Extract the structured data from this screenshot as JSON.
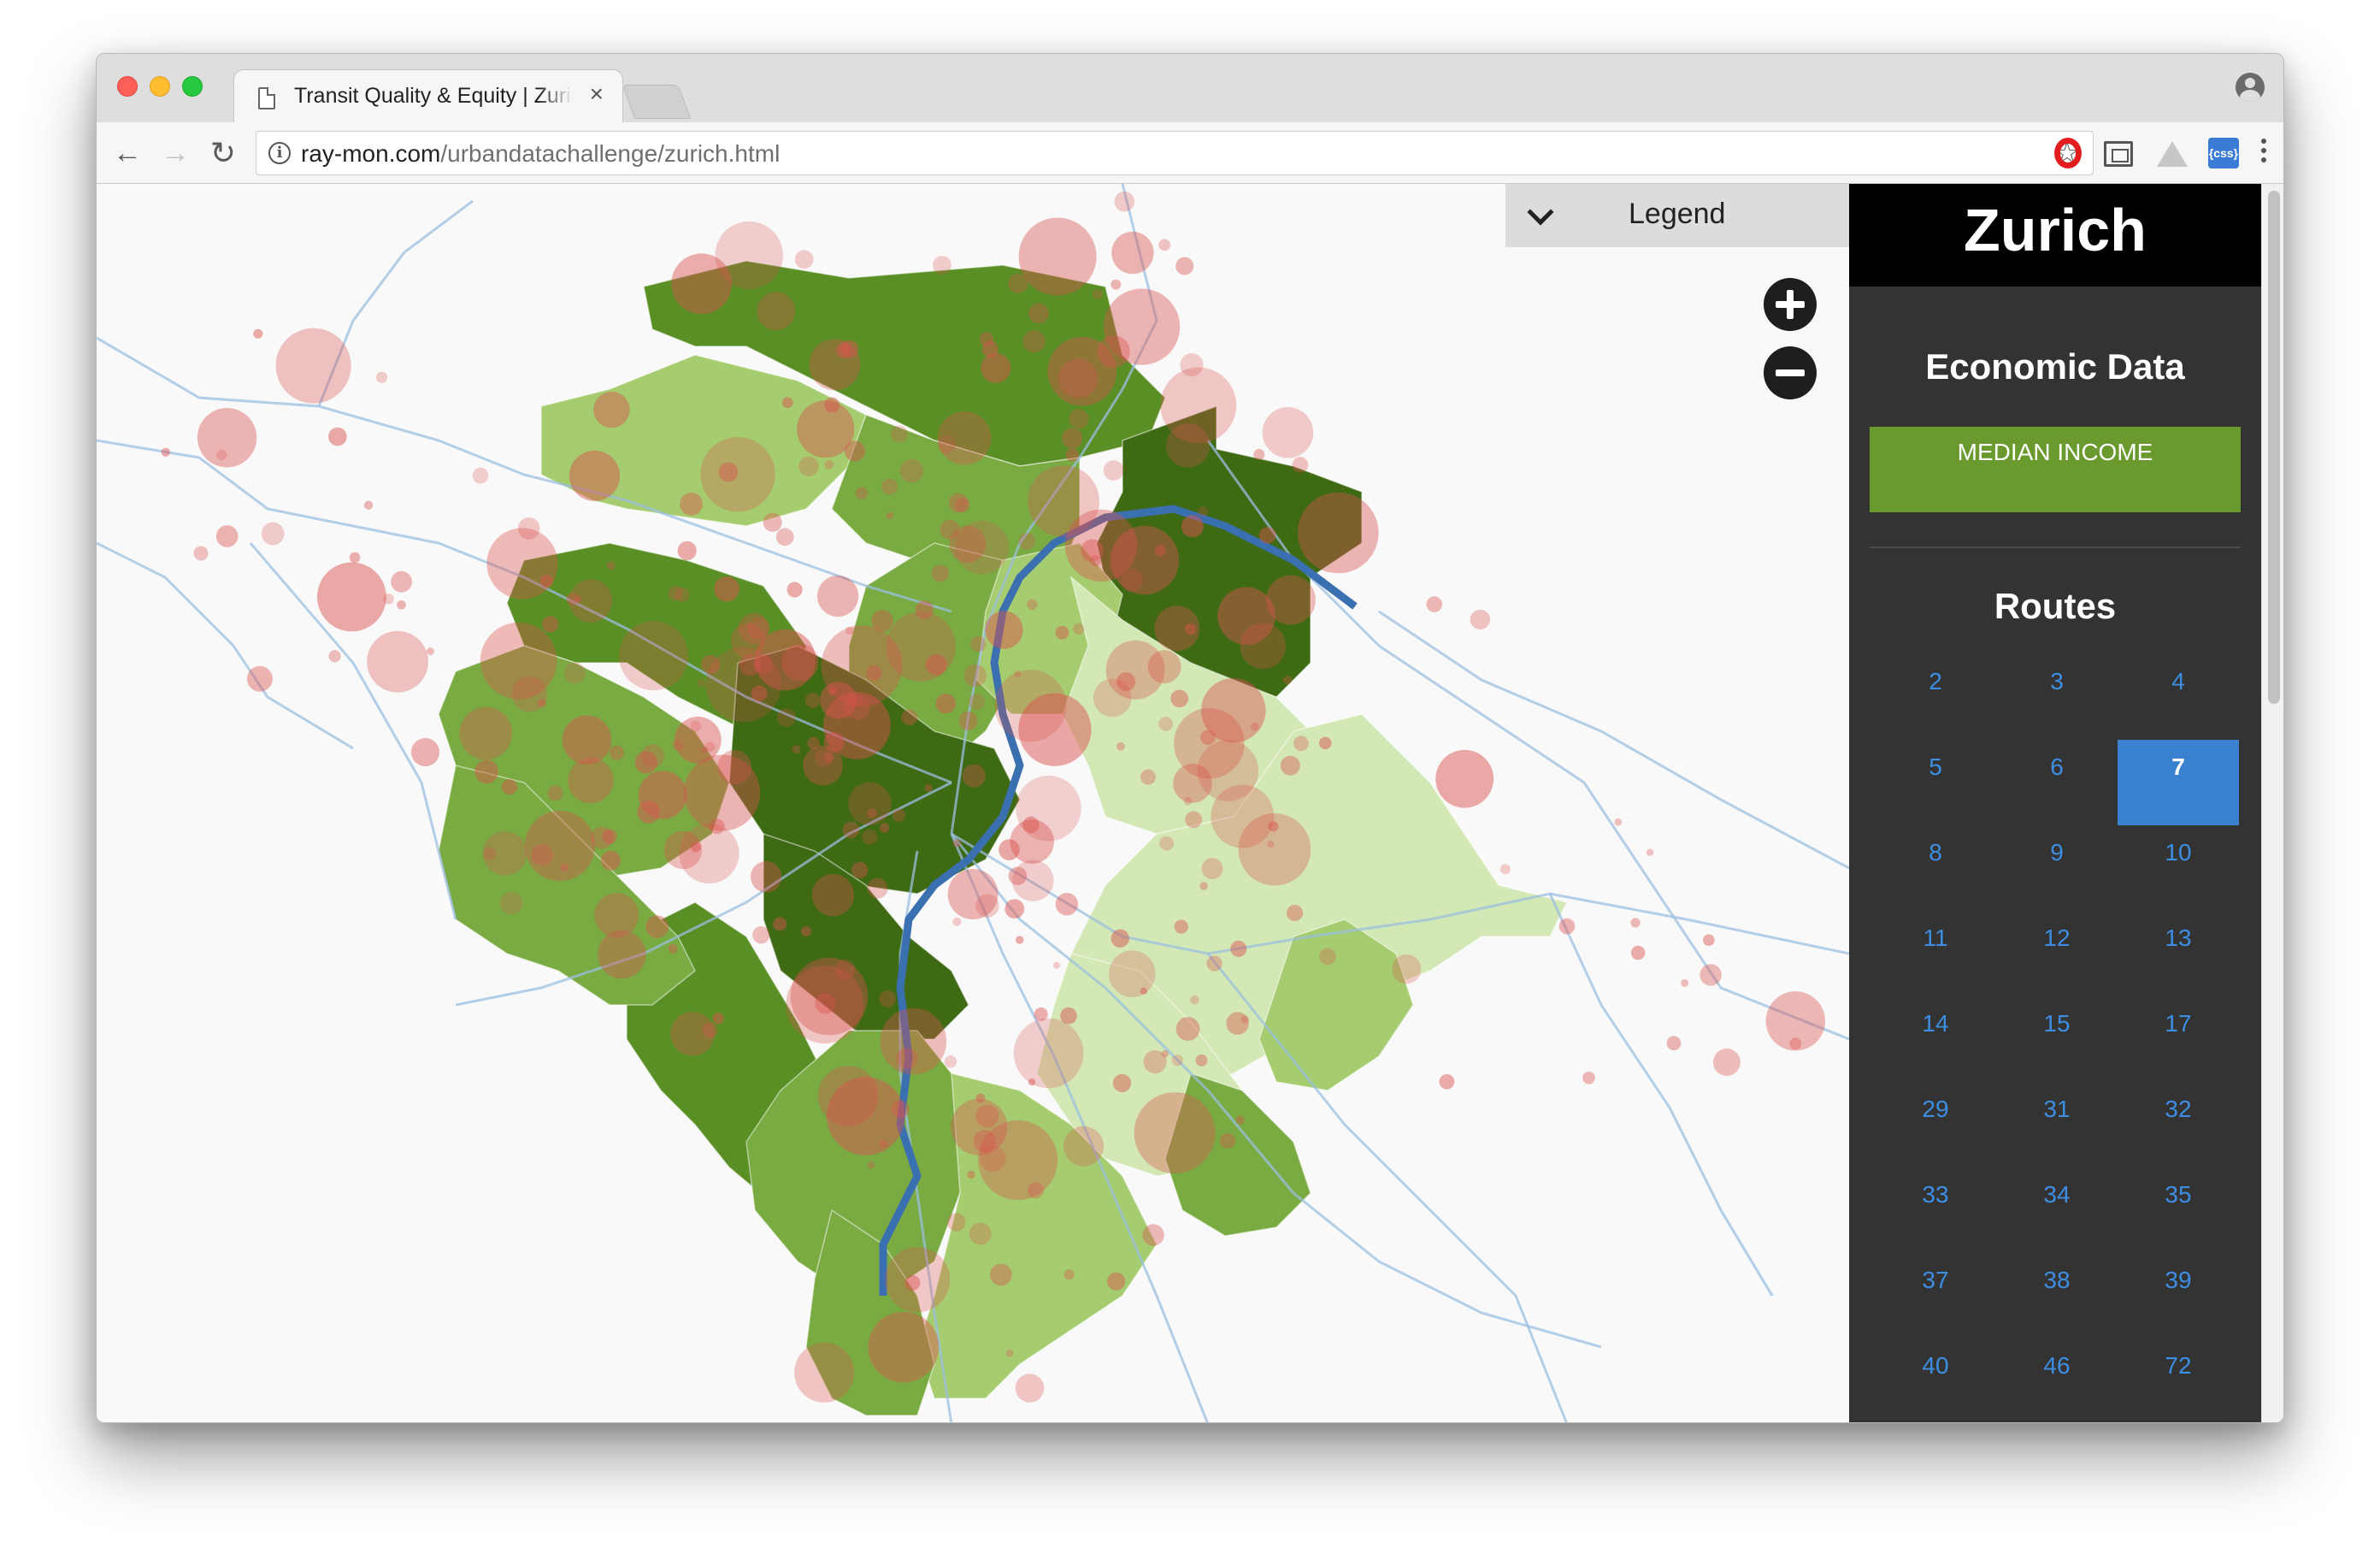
{
  "browser": {
    "tab_title": "Transit Quality & Equity | Zurich",
    "tab_close": "×",
    "url_domain": "ray-mon.com",
    "url_path": "/urbandatachallenge/zurich.html",
    "info_icon": "i",
    "icons": [
      "back-icon",
      "forward-icon",
      "reload-icon",
      "star-icon",
      "opera-icon",
      "frame-icon",
      "drive-icon",
      "css-icon",
      "menu-icon",
      "profile-icon"
    ]
  },
  "map": {
    "legend_label": "Legend",
    "zoom_in": "zoom-in-icon",
    "zoom_out": "zoom-out-icon",
    "colors": {
      "income_darkest": "#3f6a14",
      "income_dark": "#5a8f26",
      "income_mid": "#7aab43",
      "income_light": "#a5cc6e",
      "income_lightest": "#d3e8b4",
      "stops": "#d9534f",
      "lines": "#9bbfe0",
      "selected_route": "#3a6fb0"
    }
  },
  "sidebar": {
    "city": "Zurich",
    "economic_title": "Economic Data",
    "median_income_label": "MEDIAN INCOME",
    "routes_title": "Routes",
    "selected_route": "7",
    "routes": [
      "2",
      "3",
      "4",
      "5",
      "6",
      "7",
      "8",
      "9",
      "10",
      "11",
      "12",
      "13",
      "14",
      "15",
      "17",
      "29",
      "31",
      "32",
      "33",
      "34",
      "35",
      "37",
      "38",
      "39",
      "40",
      "46",
      "72"
    ]
  }
}
